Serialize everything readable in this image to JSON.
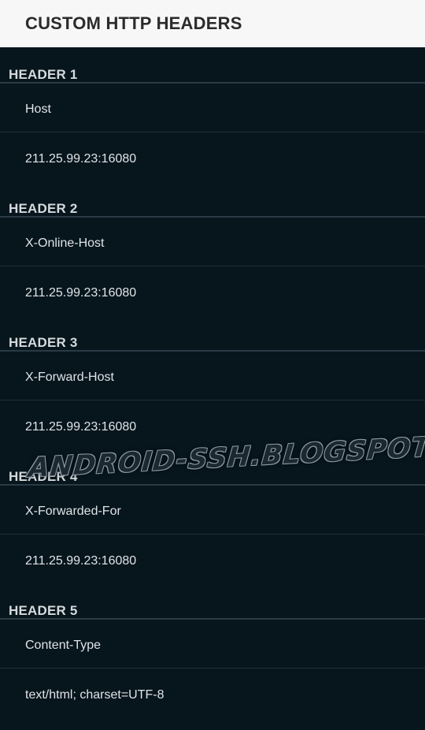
{
  "appbar": {
    "title": "CUSTOM HTTP HEADERS"
  },
  "sections": [
    {
      "title": "HEADER 1",
      "name": "Host",
      "value": "211.25.99.23:16080"
    },
    {
      "title": "HEADER 2",
      "name": "X-Online-Host",
      "value": "211.25.99.23:16080"
    },
    {
      "title": "HEADER 3",
      "name": "X-Forward-Host",
      "value": "211.25.99.23:16080"
    },
    {
      "title": "HEADER 4",
      "name": "X-Forwarded-For",
      "value": "211.25.99.23:16080"
    },
    {
      "title": "HEADER 5",
      "name": "Content-Type",
      "value": "text/html; charset=UTF-8"
    }
  ],
  "watermark": "ANDROID-SSH.BLOGSPOT.COM",
  "colors": {
    "background": "#07151d",
    "appbar": "#f7f7f7",
    "divider": "#2a3b45"
  }
}
